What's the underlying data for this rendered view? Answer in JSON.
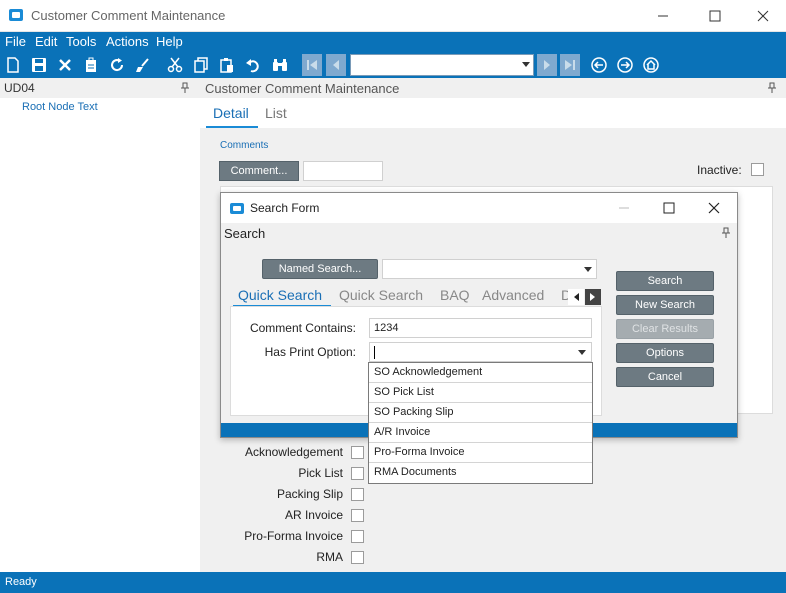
{
  "window": {
    "title": "Customer Comment Maintenance"
  },
  "menu": [
    "File",
    "Edit",
    "Tools",
    "Actions",
    "Help"
  ],
  "left_pane": {
    "title": "UD04",
    "tree_root": "Root Node Text"
  },
  "main": {
    "header": "Customer Comment Maintenance",
    "tabs": [
      "Detail",
      "List"
    ],
    "group_label": "Comments",
    "comment_button": "Comment...",
    "comment_value": "",
    "inactive_label": "Inactive:",
    "print_options": [
      "Acknowledgement",
      "Pick List",
      "Packing Slip",
      "AR Invoice",
      "Pro-Forma Invoice",
      "RMA"
    ]
  },
  "search_dialog": {
    "title": "Search Form",
    "subheader": "Search",
    "named_search_button": "Named Search...",
    "named_search_value": "",
    "tabs": [
      "Quick Search",
      "Quick Search",
      "BAQ",
      "Advanced",
      "D"
    ],
    "comment_contains_label": "Comment Contains:",
    "comment_contains_value": "1234",
    "has_print_option_label": "Has Print Option:",
    "has_print_option_value": "",
    "buttons": {
      "search": "Search",
      "new_search": "New Search",
      "clear_results": "Clear Results",
      "options": "Options",
      "cancel": "Cancel"
    },
    "dropdown_options": [
      "SO Acknowledgement",
      "SO Pick List",
      "SO Packing Slip",
      "A/R Invoice",
      "Pro-Forma Invoice",
      "RMA Documents"
    ]
  },
  "status": "Ready",
  "colors": {
    "brand_blue": "#0a72b8",
    "link_blue": "#1a6fb5",
    "button_gray": "#6d7a82"
  }
}
